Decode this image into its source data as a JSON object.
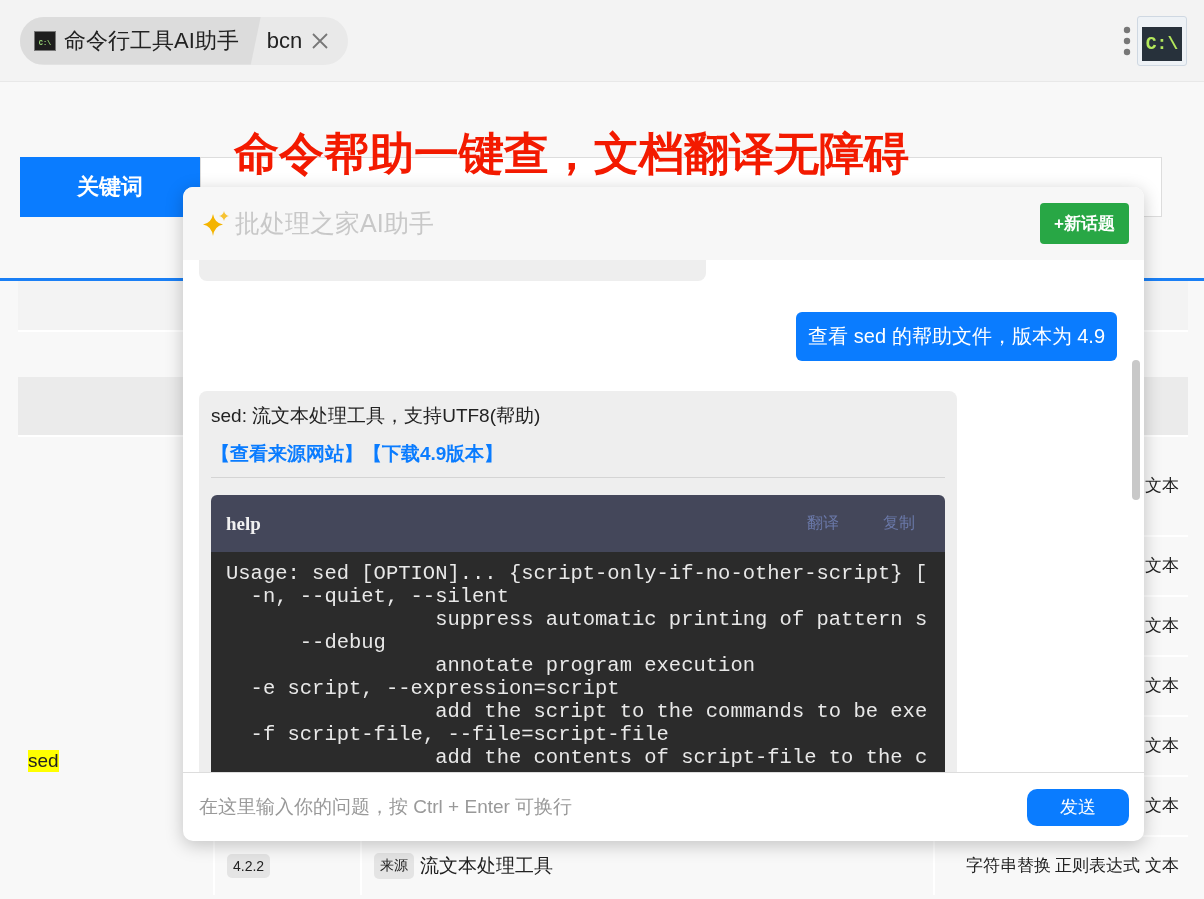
{
  "tabs": [
    {
      "label": "命令行工具AI助手",
      "selected": true,
      "icon_text": "C:\\"
    },
    {
      "label": "bcn",
      "selected": false,
      "closable": true
    }
  ],
  "app_button": {
    "text": "C:\\"
  },
  "search": {
    "label": "关键词",
    "headline": "命令帮助一键查，文档翻译无障碍"
  },
  "table": {
    "command": "sed",
    "rows": [
      {
        "tags": "文本"
      },
      {
        "tags": "文本"
      },
      {
        "tags": "文本"
      },
      {
        "tags": "文本"
      },
      {
        "tags": "文本"
      },
      {
        "tags": "文本"
      },
      {
        "version": "4.2.2",
        "source": "来源",
        "description": "流文本处理工具",
        "tags": "字符串替换 正则表达式 文本"
      }
    ]
  },
  "chat": {
    "title": "批处理之家AI助手",
    "new_topic": "+新话题",
    "messages": [
      {
        "kind": "clipped"
      },
      {
        "kind": "user",
        "text": "查看 sed 的帮助文件，版本为 4.9"
      },
      {
        "kind": "assistant",
        "text": "sed: 流文本处理工具，支持UTF8(帮助)",
        "links": [
          "【查看来源网站】",
          "【下载4.9版本】"
        ],
        "code": {
          "title": "help",
          "actions": [
            "翻译",
            "复制"
          ],
          "lines": [
            "Usage: sed [OPTION]... {script-only-if-no-other-script} [",
            "  -n, --quiet, --silent",
            "                 suppress automatic printing of pattern s",
            "      --debug",
            "                 annotate program execution",
            "  -e script, --expression=script",
            "                 add the script to the commands to be exe",
            "  -f script-file, --file=script-file",
            "                 add the contents of script-file to the c"
          ]
        }
      }
    ],
    "placeholder": "在这里输入你的问题，按 Ctrl + Enter 可换行",
    "send": "发送"
  }
}
